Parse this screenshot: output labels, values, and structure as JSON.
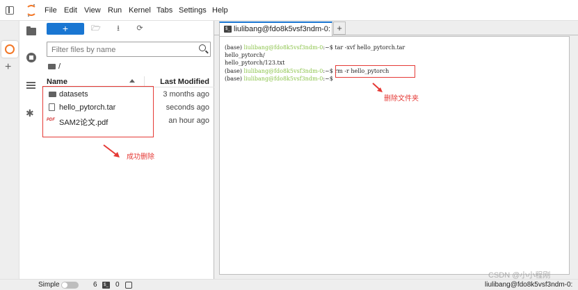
{
  "menubar": {
    "items": [
      "File",
      "Edit",
      "View",
      "Run",
      "Kernel",
      "Tabs",
      "Settings",
      "Help"
    ]
  },
  "activity": {
    "icons": [
      "folder-icon",
      "running-icon",
      "toc-icon",
      "extension-icon"
    ],
    "add_label": "+"
  },
  "filebrowser": {
    "new_launcher_label": "+",
    "filter_placeholder": "Filter files by name",
    "breadcrumb": "/",
    "columns": {
      "name": "Name",
      "modified": "Last Modified"
    },
    "files": [
      {
        "name": "datasets",
        "modified": "3 months ago",
        "type": "folder"
      },
      {
        "name": "hello_pytorch.tar",
        "modified": "seconds ago",
        "type": "file"
      },
      {
        "name": "SAM2论文.pdf",
        "modified": "an hour ago",
        "type": "pdf"
      }
    ],
    "pdf_badge": "PDF"
  },
  "annotations": {
    "success_delete": "成功删除",
    "delete_folder": "删除文件夹"
  },
  "tabs": {
    "terminal_tab_label": "liulibang@fdo8k5vsf3ndm-0:",
    "add_tab_label": "+"
  },
  "terminal": {
    "lines": [
      {
        "prefix": "(base) ",
        "user": "liulibang@fdo8k5vsf3ndm-0",
        "suffix": ":~$ tar -xvf hello_pytorch.tar"
      },
      {
        "prefix": "hello_pytorch/",
        "user": "",
        "suffix": ""
      },
      {
        "prefix": "hello_pytorch/123.txt",
        "user": "",
        "suffix": ""
      },
      {
        "prefix": "(base) ",
        "user": "liulibang@fdo8k5vsf3ndm-0",
        "suffix": ":~$ rm -r hello_pytorch"
      },
      {
        "prefix": "(base) ",
        "user": "liulibang@fdo8k5vsf3ndm-0",
        "suffix": ":~$ "
      }
    ]
  },
  "statusbar": {
    "mode_label": "Simple",
    "kernels": "6",
    "terminal_glyph": "$_",
    "terminals": "0",
    "right_text": "liulibang@fdo8k5vsf3ndm-0: "
  },
  "watermark": "CSDN @小小程刚"
}
